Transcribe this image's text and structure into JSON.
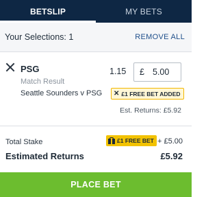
{
  "tabs": [
    {
      "label": "BETSLIP",
      "active": true
    },
    {
      "label": "MY BETS",
      "active": false
    }
  ],
  "selections_bar": {
    "count_text": "Your Selections: 1",
    "remove_all": "REMOVE ALL"
  },
  "bet": {
    "selection": "PSG",
    "market": "Match Result",
    "event": "Seattle Sounders v PSG",
    "odds": "1.15",
    "stake_currency": "£",
    "stake_value": "5.00",
    "free_bet_added": "£1 FREE BET ADDED",
    "est_returns": "Est. Returns: £5.92"
  },
  "totals": {
    "total_stake_label": "Total Stake",
    "free_bet_badge": "£1 FREE BET",
    "plus_stake": "+ £5.00",
    "est_returns_label": "Estimated Returns",
    "est_returns_value": "£5.92"
  },
  "place_bet_label": "PLACE BET",
  "colors": {
    "header_navy": "#0e2744",
    "accent_green": "#6cbd2f",
    "free_bet_yellow": "#f2c200",
    "link_blue": "#1f4f8b"
  },
  "icons": {
    "remove_selection": "close-icon",
    "free_bet_remove": "close-icon",
    "free_bet": "gift-icon"
  }
}
